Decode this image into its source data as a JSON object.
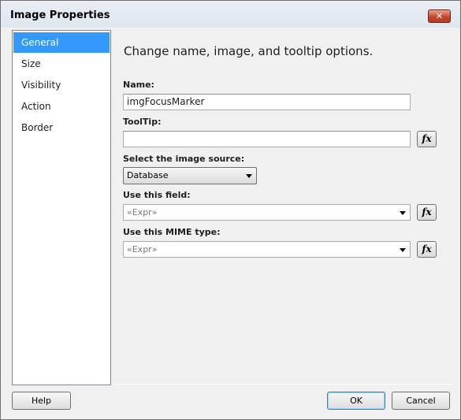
{
  "window": {
    "title": "Image Properties",
    "close_glyph": "✕"
  },
  "nav": {
    "items": [
      {
        "label": "General",
        "selected": true
      },
      {
        "label": "Size",
        "selected": false
      },
      {
        "label": "Visibility",
        "selected": false
      },
      {
        "label": "Action",
        "selected": false
      },
      {
        "label": "Border",
        "selected": false
      }
    ]
  },
  "general": {
    "heading": "Change name, image, and tooltip options.",
    "name_label": "Name:",
    "name_value": "imgFocusMarker",
    "tooltip_label": "ToolTip:",
    "tooltip_value": "",
    "source_label": "Select the image source:",
    "source_value": "Database",
    "field_label": "Use this field:",
    "field_value": "«Expr»",
    "mime_label": "Use this MIME type:",
    "mime_value": "«Expr»",
    "fx_label": "fx"
  },
  "buttons": {
    "help": "Help",
    "ok": "OK",
    "cancel": "Cancel"
  },
  "colors": {
    "selection": "#3399ff",
    "close_button": "#c4472b"
  }
}
